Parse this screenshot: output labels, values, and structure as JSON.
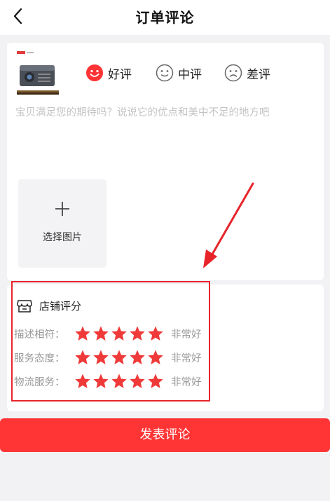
{
  "header": {
    "title": "订单评论",
    "back_icon": "chevron-left-icon"
  },
  "product": {
    "image_icon": "projector-thumbnail"
  },
  "rating_options": [
    {
      "label": "好评",
      "icon": "smile-face-filled-icon",
      "selected": true
    },
    {
      "label": "中评",
      "icon": "neutral-face-icon",
      "selected": false
    },
    {
      "label": "差评",
      "icon": "sad-face-icon",
      "selected": false
    }
  ],
  "review": {
    "placeholder": "宝贝满足您的期待吗？说说它的优点和美中不足的地方吧",
    "value": ""
  },
  "upload": {
    "label": "选择图片",
    "icon": "plus-icon"
  },
  "shop_rating": {
    "title": "店铺评分",
    "icon": "store-icon",
    "rows": [
      {
        "label": "描述相符：",
        "stars": 5,
        "max": 5,
        "text": "非常好"
      },
      {
        "label": "服务态度：",
        "stars": 5,
        "max": 5,
        "text": "非常好"
      },
      {
        "label": "物流服务：",
        "stars": 5,
        "max": 5,
        "text": "非常好"
      }
    ]
  },
  "submit": {
    "label": "发表评论"
  },
  "colors": {
    "accent": "#fe3435",
    "star": "#f03a3a",
    "annotation": "#e8242b"
  }
}
